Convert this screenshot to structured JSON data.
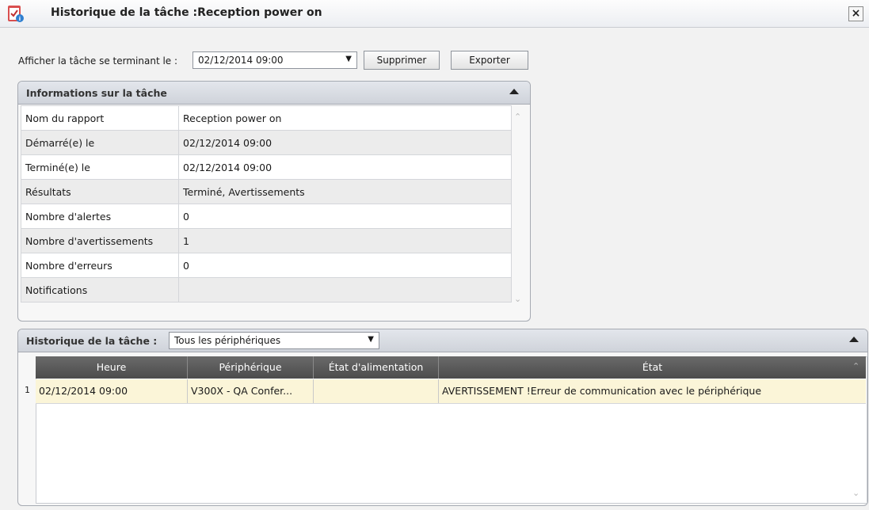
{
  "window": {
    "title": "Historique de la tâche :Reception power on",
    "close_label": "×"
  },
  "toolbar": {
    "label": "Afficher la tâche se terminant le :",
    "date_value": "02/12/2014 09:00",
    "delete_label": "Supprimer",
    "export_label": "Exporter"
  },
  "info_panel": {
    "title": "Informations sur la tâche",
    "rows": [
      {
        "key": "Nom du rapport",
        "value": "Reception power on"
      },
      {
        "key": "Démarré(e) le",
        "value": "02/12/2014 09:00"
      },
      {
        "key": "Terminé(e) le",
        "value": "02/12/2014 09:00"
      },
      {
        "key": "Résultats",
        "value": "Terminé, Avertissements"
      },
      {
        "key": "Nombre d'alertes",
        "value": "0"
      },
      {
        "key": "Nombre d'avertissements",
        "value": "1"
      },
      {
        "key": "Nombre d'erreurs",
        "value": "0"
      },
      {
        "key": "Notifications",
        "value": ""
      }
    ]
  },
  "history_panel": {
    "title": "Historique de la tâche :",
    "filter_value": "Tous les périphériques",
    "columns": [
      "Heure",
      "Périphérique",
      "État d'alimentation",
      "État"
    ],
    "rows": [
      {
        "num": "1",
        "heure": "02/12/2014 09:00",
        "peripherique": "V300X - QA Confer...",
        "alimentation": "",
        "etat": "AVERTISSEMENT !Erreur de communication avec le périphérique"
      }
    ]
  },
  "colors": {
    "header_dark": "#555555",
    "row_highlight": "#fbf5d8",
    "panel_header": "#d8dbe1"
  }
}
